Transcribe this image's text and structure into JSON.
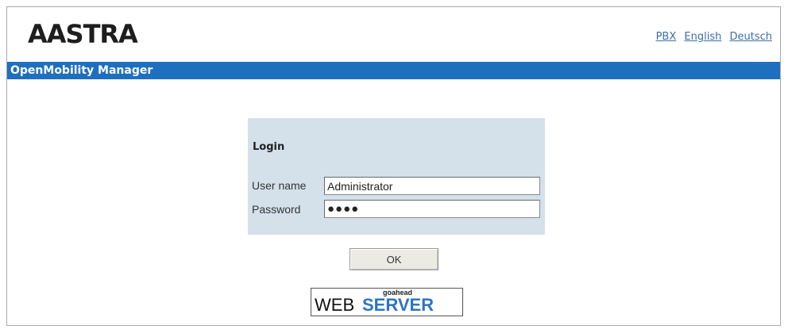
{
  "brand": {
    "logo_text": "AASTRA"
  },
  "top_links": {
    "pbx": "PBX",
    "english": "English",
    "deutsch": "Deutsch"
  },
  "title_bar": {
    "title": "OpenMobility Manager"
  },
  "login": {
    "heading": "Login",
    "username_label": "User name",
    "username_value": "Administrator",
    "password_label": "Password",
    "password_masked": "●●●●",
    "ok_label": "OK"
  },
  "footer_badge": {
    "top_text": "goahead",
    "web_text": "WEB",
    "server_text": "SERVER"
  },
  "colors": {
    "title_bar": "#1f6fbf",
    "login_panel": "#d4e0ea",
    "link": "#3c6ea8"
  }
}
